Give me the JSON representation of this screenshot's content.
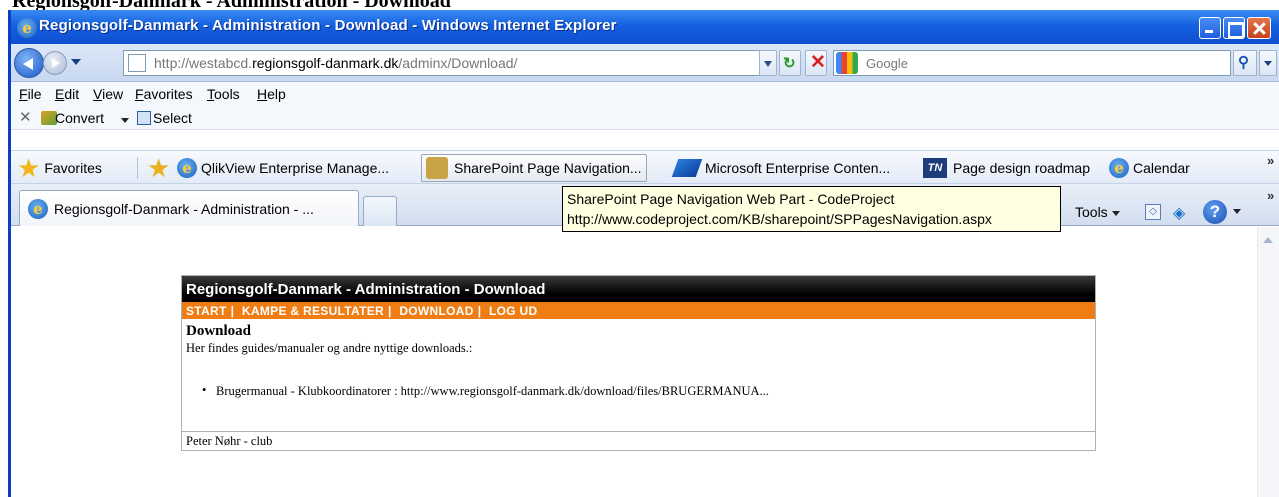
{
  "caption": "Regionsgolf-Danmark - Administration - Download",
  "window": {
    "title": "Regionsgolf-Danmark - Administration - Download - Windows Internet Explorer"
  },
  "address": {
    "url_prefix": "http://westabcd.",
    "url_domain": "regionsgolf-danmark.dk",
    "url_path": "/adminx/Download/"
  },
  "search": {
    "placeholder": "Google"
  },
  "menu": [
    "File",
    "Edit",
    "View",
    "Favorites",
    "Tools",
    "Help"
  ],
  "convert_bar": {
    "convert_label": "Convert",
    "select_label": "Select"
  },
  "favorites_bar": {
    "favorites_label": "Favorites",
    "items": [
      "QlikView Enterprise Manage...",
      "SharePoint Page Navigation...",
      "Microsoft Enterprise Conten...",
      "Page design roadmap",
      "Calendar"
    ]
  },
  "tabs": {
    "active_label": "Regionsgolf-Danmark - Administration - ..."
  },
  "command_bar": {
    "tools_label": "Tools"
  },
  "tooltip": {
    "line1": "SharePoint Page Navigation Web Part - CodeProject",
    "line2": "http://www.codeproject.com/KB/sharepoint/SPPagesNavigation.aspx"
  },
  "site": {
    "header": "Regionsgolf-Danmark - Administration - Download",
    "nav": [
      "START",
      "KAMPE & RESULTATER",
      "DOWNLOAD",
      "LOG UD"
    ],
    "heading": "Download",
    "description": "Her findes guides/manualer og andre nyttige downloads.:",
    "download_item": "Brugermanual - Klubkoordinatorer : http://www.regionsgolf-danmark.dk/download/files/BRUGERMANUA...",
    "footer": "Peter Nøhr - club"
  },
  "colors": {
    "titlebar": "#1560e0",
    "site_nav": "#ef7d14",
    "site_header": "#000000",
    "tooltip_bg": "#ffffe1"
  }
}
